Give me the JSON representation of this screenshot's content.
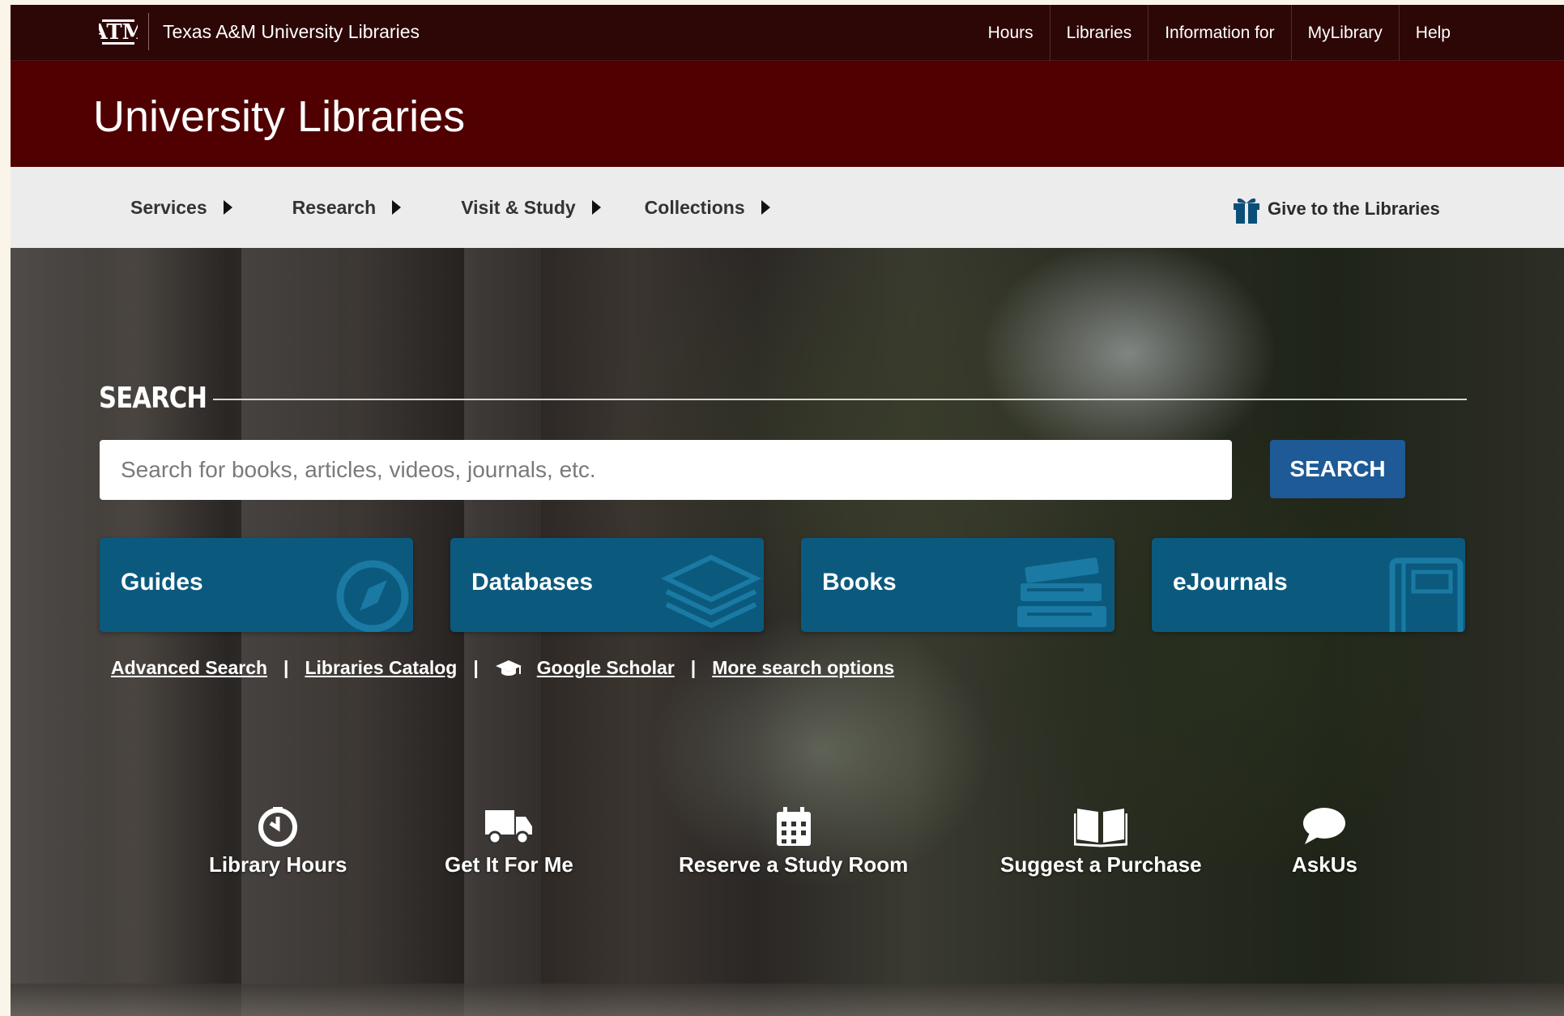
{
  "topbar": {
    "logo_text": "ATM",
    "site_name": "Texas A&M University Libraries",
    "nav": [
      "Hours",
      "Libraries",
      "Information for",
      "MyLibrary",
      "Help"
    ]
  },
  "title": "University Libraries",
  "subnav": {
    "items": [
      "Services",
      "Research",
      "Visit & Study",
      "Collections"
    ],
    "give_label": "Give to the Libraries"
  },
  "search": {
    "heading": "SEARCH",
    "placeholder": "Search for books, articles, videos, journals, etc.",
    "button_label": "SEARCH"
  },
  "tiles": [
    "Guides",
    "Databases",
    "Books",
    "eJournals"
  ],
  "links": {
    "advanced": "Advanced Search",
    "catalog": "Libraries Catalog",
    "scholar": "Google Scholar",
    "more": "More search options",
    "separator": "|"
  },
  "quick_links": [
    {
      "label": "Library Hours",
      "icon": "clock-icon"
    },
    {
      "label": "Get It For Me",
      "icon": "truck-icon"
    },
    {
      "label": "Reserve a Study Room",
      "icon": "calendar-icon"
    },
    {
      "label": "Suggest a Purchase",
      "icon": "open-book-icon"
    },
    {
      "label": "AskUs",
      "icon": "chat-bubble-icon"
    }
  ],
  "colors": {
    "maroon": "#500000",
    "topbar": "#2d0606",
    "tile_blue": "#0b5a7e",
    "button_blue": "#1d5a96"
  }
}
